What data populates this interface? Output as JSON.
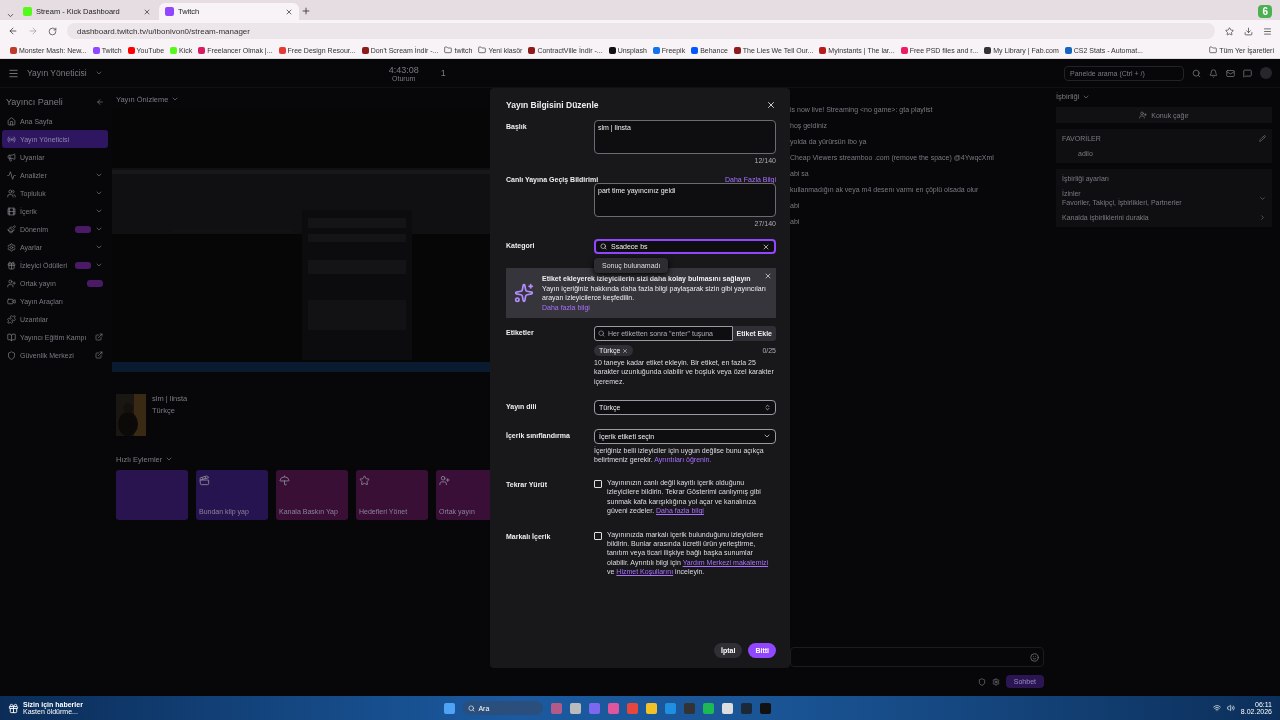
{
  "browser": {
    "tabs": [
      {
        "title": "Stream - Kick Dashboard",
        "selected": false
      },
      {
        "title": "Twitch",
        "selected": true
      }
    ],
    "url": "dashboard.twitch.tv/u/ibonivon0/stream-manager",
    "bookmarks": [
      {
        "label": "Monster Mash: New...",
        "kind": "site",
        "color": "#c0392b"
      },
      {
        "label": "Twitch",
        "kind": "site",
        "color": "#9147ff"
      },
      {
        "label": "YouTube",
        "kind": "site",
        "color": "#ff0000"
      },
      {
        "label": "Kick",
        "kind": "site",
        "color": "#53fc18"
      },
      {
        "label": "Freelancer Olmak |...",
        "kind": "site",
        "color": "#d81b60"
      },
      {
        "label": "Free Design Resour...",
        "kind": "site",
        "color": "#e53935"
      },
      {
        "label": "Don't Scream İndir -...",
        "kind": "site",
        "color": "#8e1b1b"
      },
      {
        "label": "twitch",
        "kind": "folder"
      },
      {
        "label": "Yeni klasör",
        "kind": "folder"
      },
      {
        "label": "ContractVille İndir -...",
        "kind": "site",
        "color": "#8e1b1c"
      },
      {
        "label": "Unsplash",
        "kind": "site",
        "color": "#111111"
      },
      {
        "label": "Freepik",
        "kind": "site",
        "color": "#1273eb"
      },
      {
        "label": "Behance",
        "kind": "site",
        "color": "#0057ff"
      },
      {
        "label": "The Lies We Tell Our...",
        "kind": "site",
        "color": "#8e1b1d"
      },
      {
        "label": "Myinstants | The lar...",
        "kind": "site",
        "color": "#b71c1c"
      },
      {
        "label": "Free PSD files and r...",
        "kind": "site",
        "color": "#e91e63"
      },
      {
        "label": "My Library | Fab.com",
        "kind": "site",
        "color": "#333333"
      },
      {
        "label": "CS2 Stats - Automat...",
        "kind": "site",
        "color": "#1565c0"
      }
    ],
    "all_bookmarks": "Tüm Yer İşaretleri",
    "profile_badge": "6"
  },
  "dashboard": {
    "title": "Yayın Yöneticisi",
    "session_time": "4:43:08",
    "session_label": "Oturum",
    "viewers": "1",
    "search_placeholder": "Panelde arama (Ctrl + /)",
    "sidebar_title": "Yayıncı Paneli",
    "sidebar": [
      {
        "label": "Ana Sayfa",
        "selected": false,
        "expandable": false,
        "external": false,
        "badge": false
      },
      {
        "label": "Yayın Yöneticisi",
        "selected": true,
        "expandable": false,
        "external": false,
        "badge": false
      },
      {
        "label": "Uyarılar",
        "selected": false,
        "expandable": false,
        "external": false,
        "badge": false
      },
      {
        "label": "Analizler",
        "selected": false,
        "expandable": true,
        "external": false,
        "badge": false
      },
      {
        "label": "Topluluk",
        "selected": false,
        "expandable": true,
        "external": false,
        "badge": false
      },
      {
        "label": "İçerik",
        "selected": false,
        "expandable": true,
        "external": false,
        "badge": false
      },
      {
        "label": "Dönenim",
        "selected": false,
        "expandable": true,
        "external": false,
        "badge": true
      },
      {
        "label": "Ayarlar",
        "selected": false,
        "expandable": true,
        "external": false,
        "badge": false
      },
      {
        "label": "İzleyici Ödülleri",
        "selected": false,
        "expandable": true,
        "external": false,
        "badge": true
      },
      {
        "label": "Ortak yayın",
        "selected": false,
        "expandable": false,
        "external": false,
        "badge": true
      },
      {
        "label": "Yayın Araçları",
        "selected": false,
        "expandable": false,
        "external": false,
        "badge": false
      },
      {
        "label": "Uzantılar",
        "selected": false,
        "expandable": false,
        "external": false,
        "badge": false
      },
      {
        "label": "Yayıncı Eğitim Kampı",
        "selected": false,
        "expandable": false,
        "external": true,
        "badge": false
      },
      {
        "label": "Güvenlik Merkezi",
        "selected": false,
        "expandable": false,
        "external": true,
        "badge": false
      }
    ],
    "preview_title": "Yayın Önizleme",
    "stream_title": "slm | linsta",
    "stream_language": "Türkçe",
    "quick_actions_title": "Hızlı Eylemler",
    "quick_actions": [
      {
        "color": "#2a1450"
      },
      {
        "label": "Bundan klip yap",
        "color": "#261451"
      },
      {
        "label": "Kanala Baskın Yap",
        "color": "#3a0f35"
      },
      {
        "label": "Hedefleri Yönet",
        "color": "#3a0f36"
      },
      {
        "label": "Ortak yayın",
        "color": "#3a0f37"
      }
    ],
    "chat": [
      "is now live! Streaming <no game>: gta playlist",
      "hoş geldiniz",
      "yolda da yürürsün ibo ya",
      "Cheap Viewers streamboo .com (remove the space) @4YwqcXml",
      "abi sa",
      "kullanmadığın ak veya m4 desenı varmı en çöplü olsada olur",
      "abi",
      "abi"
    ],
    "chat_button": "Sohbet",
    "collab_title": "İşbirliği",
    "invite_guest": "Konuk çağır",
    "favorites_title": "FAVORİLER",
    "favorite": "adilo",
    "collab_settings": "İşbirliği ayarları",
    "permissions": "İzinler",
    "permissions_value": "Favoriler, Takipçi, İşbirlikleri, Partnerler",
    "pause_collab": "Kanalda işbirliklerini durakla"
  },
  "modal": {
    "title": "Yayın Bilgisini Düzenle",
    "stream_title": {
      "label": "Başlık",
      "value": "slm | linsta",
      "count": "12/140"
    },
    "notification": {
      "label": "Canlı Yayına Geçiş Bildirimi",
      "link": "Daha Fazla Bilgi",
      "value": "part time yayıncınız geldi",
      "count": "27/140"
    },
    "category": {
      "label": "Kategori",
      "value": "Ssadece bs",
      "focused": true,
      "result": "Sonuç bulunamadı"
    },
    "banner": {
      "title": "Etiket ekleyerek izleyicilerin sizi daha kolay bulmasını sağlayın",
      "body": "Yayın içeriğiniz hakkında daha fazla bilgi paylaşarak sizin gibi yayıncıları arayan izleyicilerce keşfedilin.",
      "link": "Daha fazla bilgi"
    },
    "tags": {
      "label": "Etiketler",
      "placeholder": "Her etiketten sonra \"enter\" tuşuna",
      "button": "Etiket Ekle",
      "items": [
        "Türkçe"
      ],
      "count": "0/25",
      "help": "10 taneye kadar etiket ekleyin. Bir etiket, en fazla 25 karakter uzunluğunda olabilir ve boşluk veya özel karakter içeremez."
    },
    "language": {
      "label": "Yayın dili",
      "value": "Türkçe"
    },
    "classification": {
      "label": "İçerik sınıflandırma",
      "value": "İçerik etiketi seçin",
      "help": [
        {
          "kind": "text",
          "text": "İçeriğiniz belli izleyiciler için uygun değilse bunu açıkça belirtmeniz gerekir. "
        },
        {
          "kind": "link",
          "text": "Ayrıntıları öğrenin."
        }
      ]
    },
    "checks": [
      {
        "label": "Tekrar Yürüt",
        "checked": false,
        "parts": [
          {
            "kind": "text",
            "text": "Yayınınızın canlı değil kayıtlı içerik olduğunu izleyicilere bildirin. Tekrar Gösterimi canlıymış gibi sunmak kafa karışıklığına yol açar ve kanalınıza güveni zedeler. "
          },
          {
            "kind": "link",
            "text": "Daha fazla bilgi"
          }
        ]
      },
      {
        "label": "Markalı İçerik",
        "checked": false,
        "parts": [
          {
            "kind": "text",
            "text": "Yayınınızda markalı içerik bulunduğunu izleyicilere bildirin. Bunlar arasında ücretli ürün yerleştirme, tanıtım veya ticari ilişkiye bağlı başka sunumlar olabilir. Ayrıntılı bilgi için "
          },
          {
            "kind": "link",
            "text": "Yardım Merkezi makalemizi"
          },
          {
            "kind": "text",
            "text": " ve "
          },
          {
            "kind": "link",
            "text": "Hizmet Koşullarını"
          },
          {
            "kind": "text",
            "text": " inceleyin."
          }
        ]
      }
    ],
    "cancel": "İptal",
    "done": "Bitti"
  },
  "taskbar": {
    "news_title": "Sizin için haberler",
    "news_sub": "Kasten öldürme...",
    "search": "Ara",
    "time": "06:11",
    "date": "8.02.2026"
  }
}
